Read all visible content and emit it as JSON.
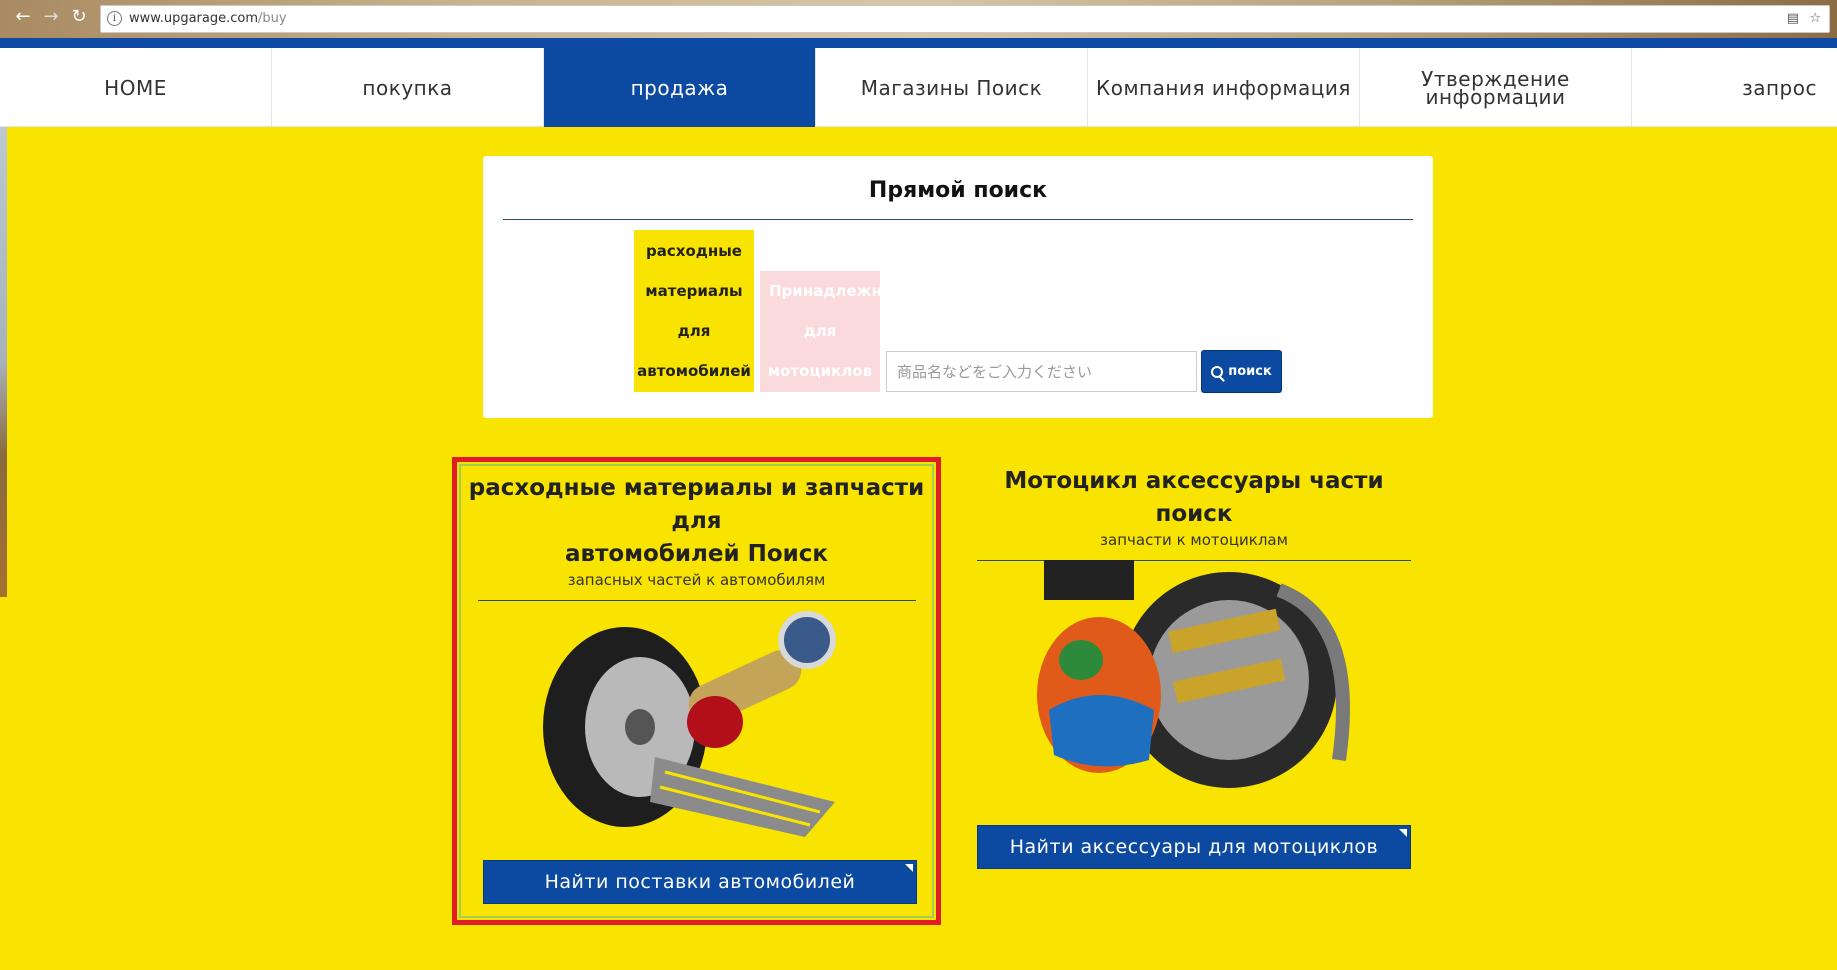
{
  "browser": {
    "url_host": "www.upgarage.com",
    "url_path": "/buy"
  },
  "nav": {
    "items": [
      {
        "label": "HOME"
      },
      {
        "label": "покупка"
      },
      {
        "label": "продажа"
      },
      {
        "label": "Магазины Поиск"
      },
      {
        "label": "Компания информация"
      },
      {
        "label": "Утверждение информации"
      },
      {
        "label": "запрос"
      }
    ],
    "active_index": 2
  },
  "search": {
    "title": "Прямой поиск",
    "tab_auto": [
      "расходные",
      "материалы",
      "для",
      "автомобилей"
    ],
    "tab_moto": [
      "Принадлежности",
      "для",
      "мотоциклов"
    ],
    "placeholder": "商品名などをご入力ください",
    "button_label": "поиск"
  },
  "cards": {
    "auto": {
      "title_line1": "расходные материалы и запчасти для",
      "title_line2": "автомобилей Поиск",
      "subtitle": "запасных частей к автомобилям",
      "button_label": "Найти поставки автомобилей"
    },
    "moto": {
      "title": "Мотоцикл аксессуары части поиск",
      "subtitle": "запчасти к мотоциклам",
      "button_label": "Найти аксессуары для мотоциклов"
    }
  },
  "colors": {
    "page_bg": "#f8e400",
    "brand_blue": "#0b4aa0",
    "highlight_red": "#e21c24"
  }
}
